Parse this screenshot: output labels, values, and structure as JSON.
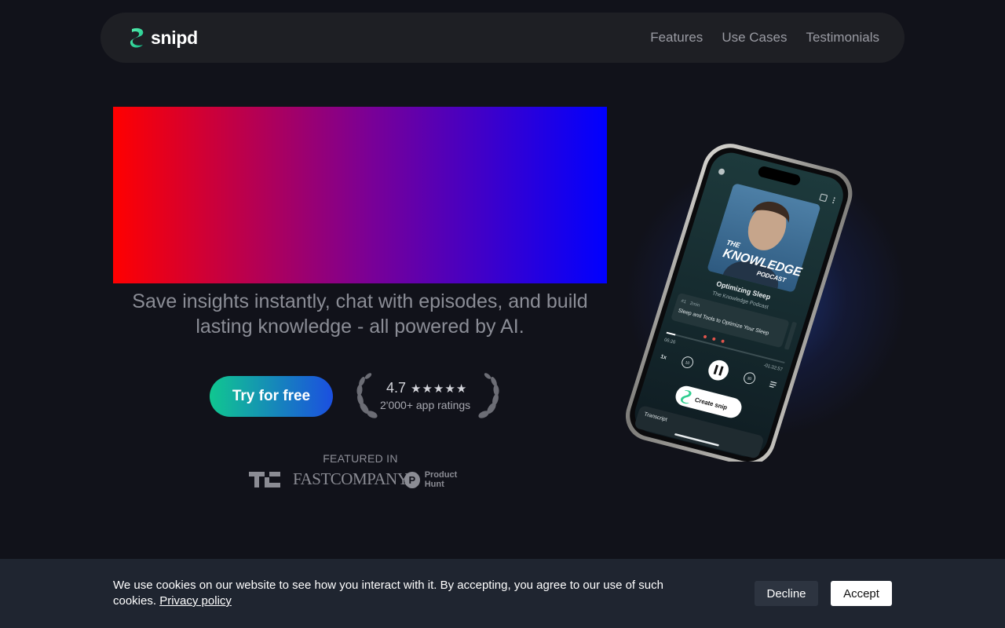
{
  "nav": {
    "logo_text": "snipd",
    "links": [
      "Features",
      "Use Cases",
      "Testimonials"
    ]
  },
  "hero": {
    "tagline": "Save insights instantly, chat with episodes, and build lasting knowledge - all powered by AI.",
    "cta_label": "Try for free",
    "rating": {
      "score": "4.7",
      "stars": "★★★★★",
      "count_label": "2'000+ app ratings"
    },
    "featured": {
      "title": "FEATURED IN",
      "logos": [
        "TC",
        "FASTCOMPANY",
        "Product Hunt"
      ],
      "ph_letter": "P"
    }
  },
  "phone": {
    "cover_line1": "THE",
    "cover_line2": "KNOWLEDGE",
    "cover_line3": "PODCAST",
    "episode_title": "Optimizing Sleep",
    "podcast_name": "The Knowledge Podcast",
    "chapter_number": "#1",
    "chapter_duration": "2min",
    "chapter_title": "Sleep and Tools to Optimize Your Sleep",
    "time_elapsed": "06:26",
    "time_remaining": "-01:32:57",
    "speed": "1x",
    "skip_back": "10",
    "skip_forward": "30",
    "create_snip": "Create snip",
    "transcript_label": "Transcript"
  },
  "cookie": {
    "text": "We use cookies on our website to see how you interact with it. By accepting, you agree to our use of such cookies.",
    "privacy_link": "Privacy policy",
    "decline": "Decline",
    "accept": "Accept"
  },
  "colors": {
    "background": "#11121a",
    "nav_bg": "#1e1f24",
    "cta_start": "#10c790",
    "cta_end": "#1b4fe0",
    "hero_red": "#ff0000",
    "hero_blue": "#0000ff",
    "cookie_bg": "#1f2530"
  }
}
